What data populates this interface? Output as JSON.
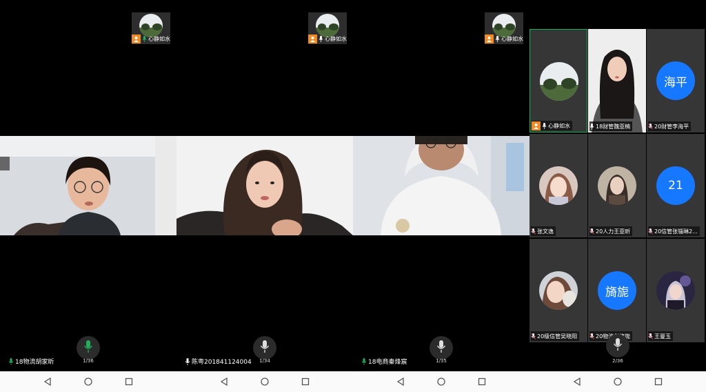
{
  "panels": [
    {
      "thumbnail": {
        "name": "心静如水"
      },
      "speaker": {
        "name": "18物流胡家昕"
      },
      "page_indicator": "1/36"
    },
    {
      "thumbnail": {
        "name": "心静如水"
      },
      "speaker": {
        "name": "陈粤201841124004"
      },
      "page_indicator": "1/34"
    },
    {
      "thumbnail": {
        "name": "心静如水"
      },
      "speaker": {
        "name": "18电商秦烽宸"
      },
      "page_indicator": "1/35"
    }
  ],
  "grid_panel": {
    "page_indicator": "2/36",
    "tiles": [
      {
        "name": "心静如水",
        "host": true
      },
      {
        "name": "18财管魏亚楠"
      },
      {
        "name": "20财管李海平",
        "initials": "海平"
      },
      {
        "name": "张文逸"
      },
      {
        "name": "20人力王亚昕"
      },
      {
        "name": "20信管张锱琳2...",
        "initials": "21"
      },
      {
        "name": "20级信管吴晓阳"
      },
      {
        "name": "20物流何旖旎",
        "initials": "旖旎"
      },
      {
        "name": "王曼玉"
      }
    ]
  },
  "colors": {
    "mic_active": "#1fae5a",
    "host_badge": "#f08a24",
    "avatar_blue": "#1677ff",
    "mic_muted": "#e0475b"
  }
}
